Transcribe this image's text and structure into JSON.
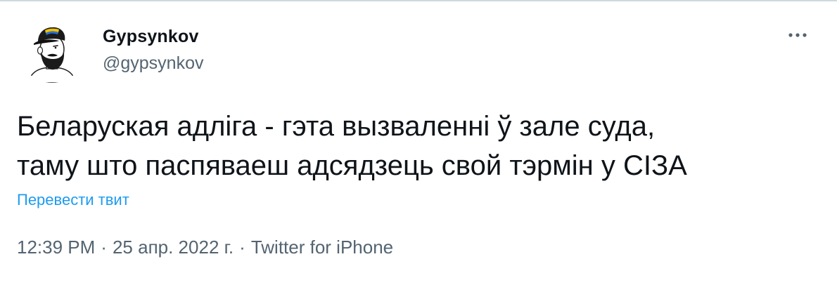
{
  "tweet": {
    "author": {
      "display_name": "Gypsynkov",
      "handle": "@gypsynkov",
      "avatar_icon": "bearded-man-with-cap-avatar"
    },
    "more_icon": "more-dots-icon",
    "text_lines": [
      "Беларуская адліга - гэта вызваленні ў зале суда,",
      "таму што паспяваеш адсядзець свой тэрмін у СІЗА"
    ],
    "translate_label": "Перевести твит",
    "time": "12:39 PM",
    "date": "25 апр. 2022 г.",
    "source": "Twitter for iPhone",
    "separator": "·",
    "colors": {
      "link": "#1d9bf0",
      "secondary_text": "#536471",
      "primary_text": "#0f1419"
    }
  }
}
